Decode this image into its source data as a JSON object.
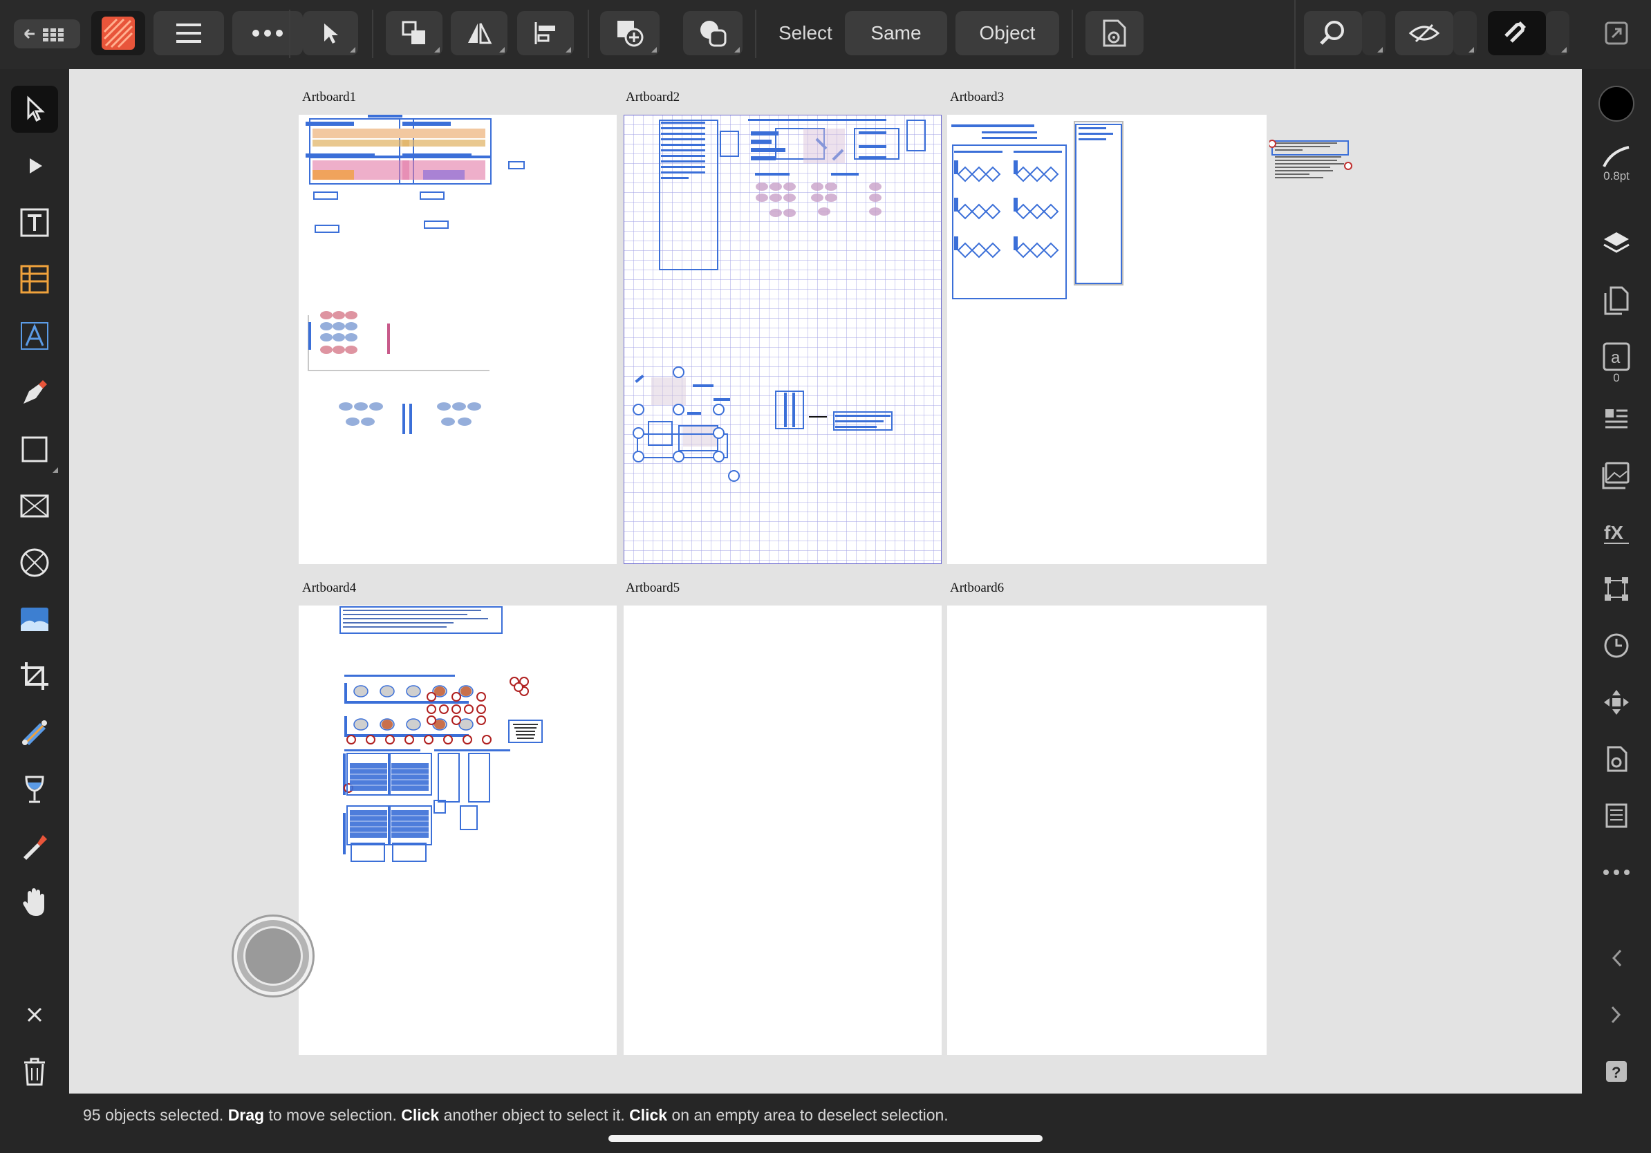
{
  "toolbar": {
    "back_icon": "back-grid-icon",
    "select_label": "Select",
    "same_label": "Same",
    "object_label": "Object"
  },
  "artboards": [
    {
      "label": "Artboard1"
    },
    {
      "label": "Artboard2"
    },
    {
      "label": "Artboard3"
    },
    {
      "label": "Artboard4"
    },
    {
      "label": "Artboard5"
    },
    {
      "label": "Artboard6"
    }
  ],
  "right_panel": {
    "stroke_width": "0.8pt",
    "text_styles_count": "0"
  },
  "status": {
    "t1": "95 objects selected. ",
    "b1": "Drag",
    "t2": " to move selection. ",
    "b2": "Click",
    "t3": " another object to select it. ",
    "b3": "Click",
    "t4": " on an empty area to deselect selection."
  },
  "colors": {
    "selection": "#3b6fd8",
    "app_icon": "#e8553a",
    "canvas_bg": "#e3e3e3"
  }
}
